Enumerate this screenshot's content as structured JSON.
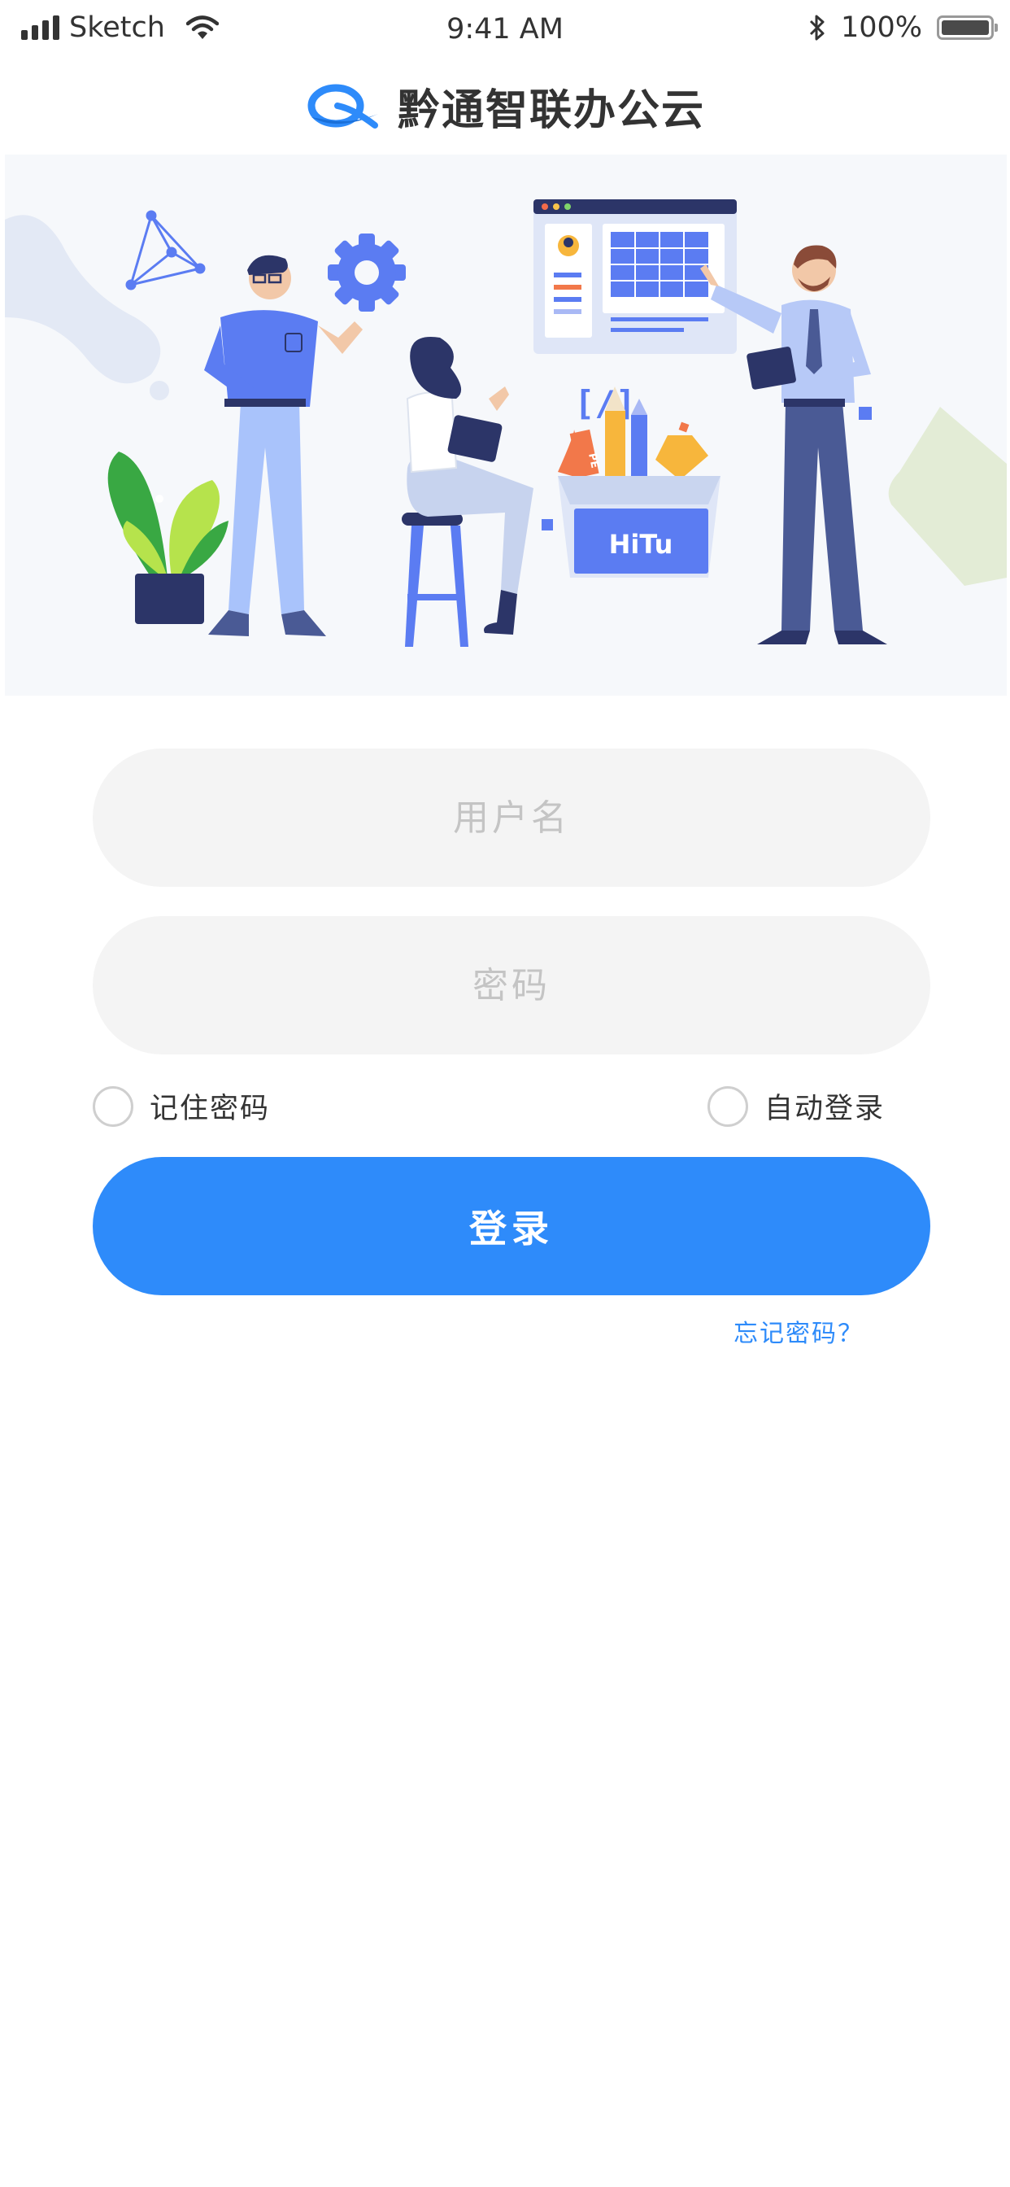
{
  "status_bar": {
    "carrier": "Sketch",
    "time": "9:41 AM",
    "battery_percent": "100%",
    "icons": [
      "signal-icon",
      "wifi-icon",
      "bluetooth-icon",
      "battery-icon"
    ]
  },
  "header": {
    "title": "黔通智联办公云",
    "logo": "q-logo-icon"
  },
  "illustration": {
    "box_label": "HiTu",
    "code_glyph": "[/]",
    "pencil_label": "PE"
  },
  "form": {
    "username_placeholder": "用户名",
    "username_value": "",
    "password_placeholder": "密码",
    "password_value": "",
    "remember_label": "记住密码",
    "remember_checked": false,
    "autologin_label": "自动登录",
    "autologin_checked": false,
    "login_label": "登录",
    "forgot_label": "忘记密码？"
  },
  "colors": {
    "primary": "#2e8bfa",
    "input_bg": "#f4f4f4",
    "placeholder": "#c4c4c4",
    "illustration_blue": "#5b7cf2"
  }
}
